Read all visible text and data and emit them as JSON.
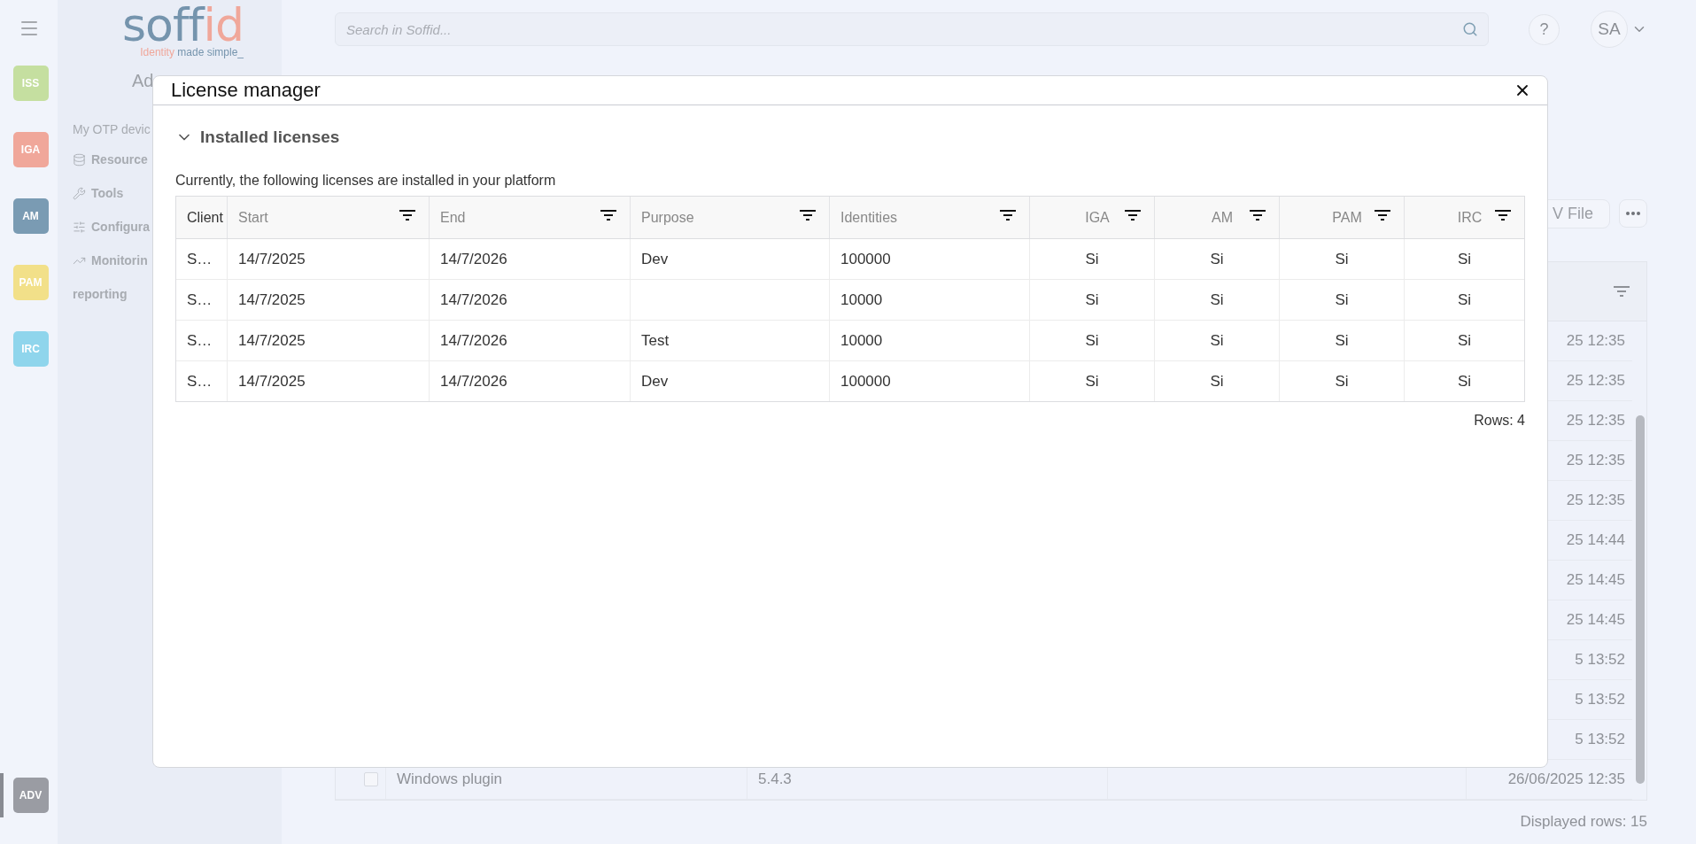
{
  "nav_rail": {
    "modules": [
      {
        "label": "ISS",
        "color": "#c5dfa0",
        "selected": false
      },
      {
        "label": "IGA",
        "color": "#f0a79a",
        "selected": false
      },
      {
        "label": "AM",
        "color": "#7a9bb3",
        "selected": false
      },
      {
        "label": "PAM",
        "color": "#f2e089",
        "selected": false
      },
      {
        "label": "IRC",
        "color": "#8fd5ec",
        "selected": false
      }
    ],
    "bottom_modules": [
      {
        "label": "ADV",
        "color": "#9a9ca3",
        "selected": true
      }
    ]
  },
  "sidebar": {
    "logo": {
      "part_1": "soff",
      "part_2": "id",
      "tagline_1": "Identity",
      "tagline_2": "made simple_"
    },
    "title": "Ad",
    "items": [
      {
        "label": "My OTP devic",
        "kind": "plain"
      },
      {
        "label": "Resource",
        "kind": "database"
      },
      {
        "label": "Tools",
        "kind": "wrench"
      },
      {
        "label": "Configura",
        "kind": "sliders"
      },
      {
        "label": "Monitorin",
        "kind": "chart"
      },
      {
        "label": "reporting",
        "kind": "continuation"
      }
    ]
  },
  "topbar": {
    "search": {
      "placeholder": "Search in Soffid..."
    },
    "help": "?",
    "user": "SA"
  },
  "background": {
    "buttons": [
      "V File"
    ],
    "table": {
      "rows": [
        {
          "date": "25 12:35"
        },
        {
          "date": "25 12:35"
        },
        {
          "date": "25 12:35"
        },
        {
          "date": "25 12:35"
        },
        {
          "date": "25 12:35"
        },
        {
          "date": "25 14:44"
        },
        {
          "date": "25 14:45"
        },
        {
          "date": "25 14:45"
        },
        {
          "date": "5 13:52"
        },
        {
          "date": "5 13:52"
        },
        {
          "date": "5 13:52"
        },
        {
          "checked": false,
          "name": "Windows plugin",
          "version": "5.4.3",
          "date": "26/06/2025 12:35"
        }
      ]
    },
    "footer": "Displayed rows: 15"
  },
  "modal": {
    "title": "License manager",
    "section": {
      "title": "Installed licenses",
      "expanded": true,
      "description": "Currently, the following licenses are installed in your platform",
      "table": {
        "columns": [
          {
            "label": "Client",
            "filter": false,
            "kind": "text"
          },
          {
            "label": "Start",
            "filter": true,
            "kind": "text"
          },
          {
            "label": "End",
            "filter": true,
            "kind": "text"
          },
          {
            "label": "Purpose",
            "filter": true,
            "kind": "text"
          },
          {
            "label": "Identities",
            "filter": true,
            "kind": "text"
          },
          {
            "label": "IGA",
            "filter": true,
            "kind": "module"
          },
          {
            "label": "AM",
            "filter": true,
            "kind": "module"
          },
          {
            "label": "PAM",
            "filter": true,
            "kind": "module"
          },
          {
            "label": "IRC",
            "filter": true,
            "kind": "module"
          }
        ],
        "rows": [
          [
            "S…",
            "14/7/2025",
            "14/7/2026",
            "Dev",
            "100000",
            "Si",
            "Si",
            "Si",
            "Si"
          ],
          [
            "S…",
            "14/7/2025",
            "14/7/2026",
            "",
            "10000",
            "Si",
            "Si",
            "Si",
            "Si"
          ],
          [
            "S…",
            "14/7/2025",
            "14/7/2026",
            "Test",
            "10000",
            "Si",
            "Si",
            "Si",
            "Si"
          ],
          [
            "S…",
            "14/7/2025",
            "14/7/2026",
            "Dev",
            "100000",
            "Si",
            "Si",
            "Si",
            "Si"
          ]
        ]
      },
      "row_count": "Rows: 4"
    }
  }
}
